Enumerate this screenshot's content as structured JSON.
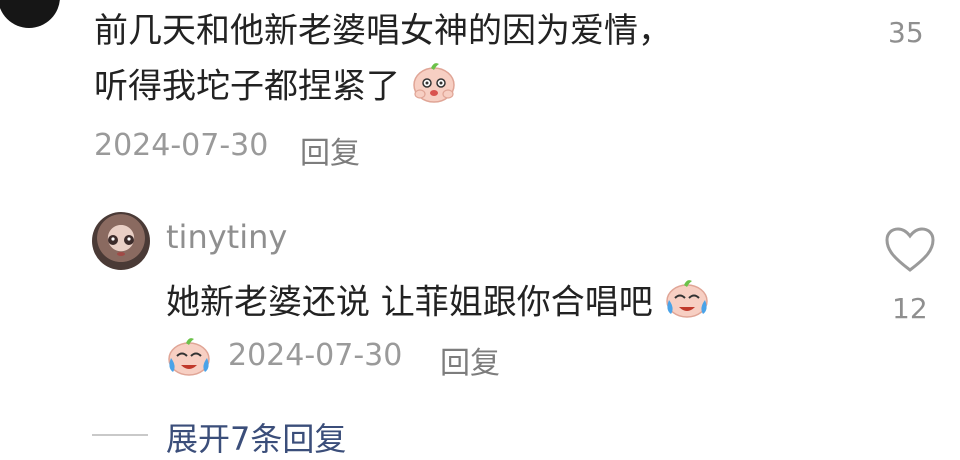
{
  "comment1": {
    "text_line1": "前几天和他新老婆唱女神的因为爱情，",
    "text_line2": "听得我坨子都捏紧了",
    "emoji": "nervous-face-icon",
    "date": "2024-07-30",
    "reply_label": "回复",
    "like_count": "35"
  },
  "reply1": {
    "username": "tinytiny",
    "text": "她新老婆还说 让菲姐跟你合唱吧",
    "emoji": "crying-laugh-face-icon",
    "date": "2024-07-30",
    "reply_label": "回复",
    "like_count": "12"
  },
  "expand_replies": {
    "label": "展开7条回复"
  },
  "colors": {
    "text": "#222222",
    "meta": "#9a9a9a",
    "link": "#3b4e7a"
  }
}
